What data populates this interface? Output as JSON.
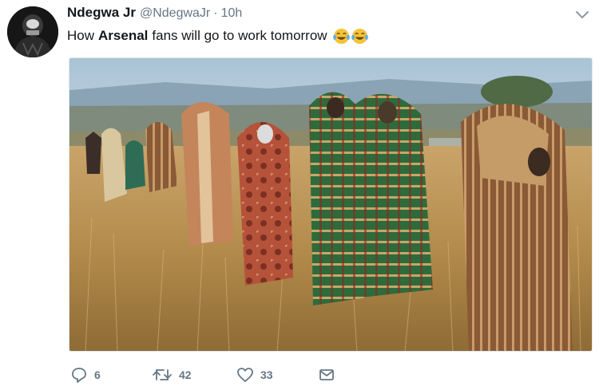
{
  "tweet": {
    "display_name": "Ndegwa Jr",
    "handle": "@NdegwaJr",
    "separator": "·",
    "time": "10h",
    "text_parts": {
      "before": "How",
      "bold": "Arsenal",
      "after": "fans will go to work tomorrow"
    },
    "emoji": [
      "face-with-tears-of-joy",
      "face-with-tears-of-joy"
    ]
  },
  "actions": {
    "replies": "6",
    "retweets": "42",
    "likes": "33"
  },
  "icons": {
    "reply": "reply-icon",
    "retweet": "retweet-icon",
    "like": "heart-icon",
    "dm": "envelope-icon",
    "caret": "chevron-down-icon"
  },
  "colors": {
    "text": "#14171a",
    "secondary": "#657786",
    "emoji_face": "#f5c33b"
  }
}
